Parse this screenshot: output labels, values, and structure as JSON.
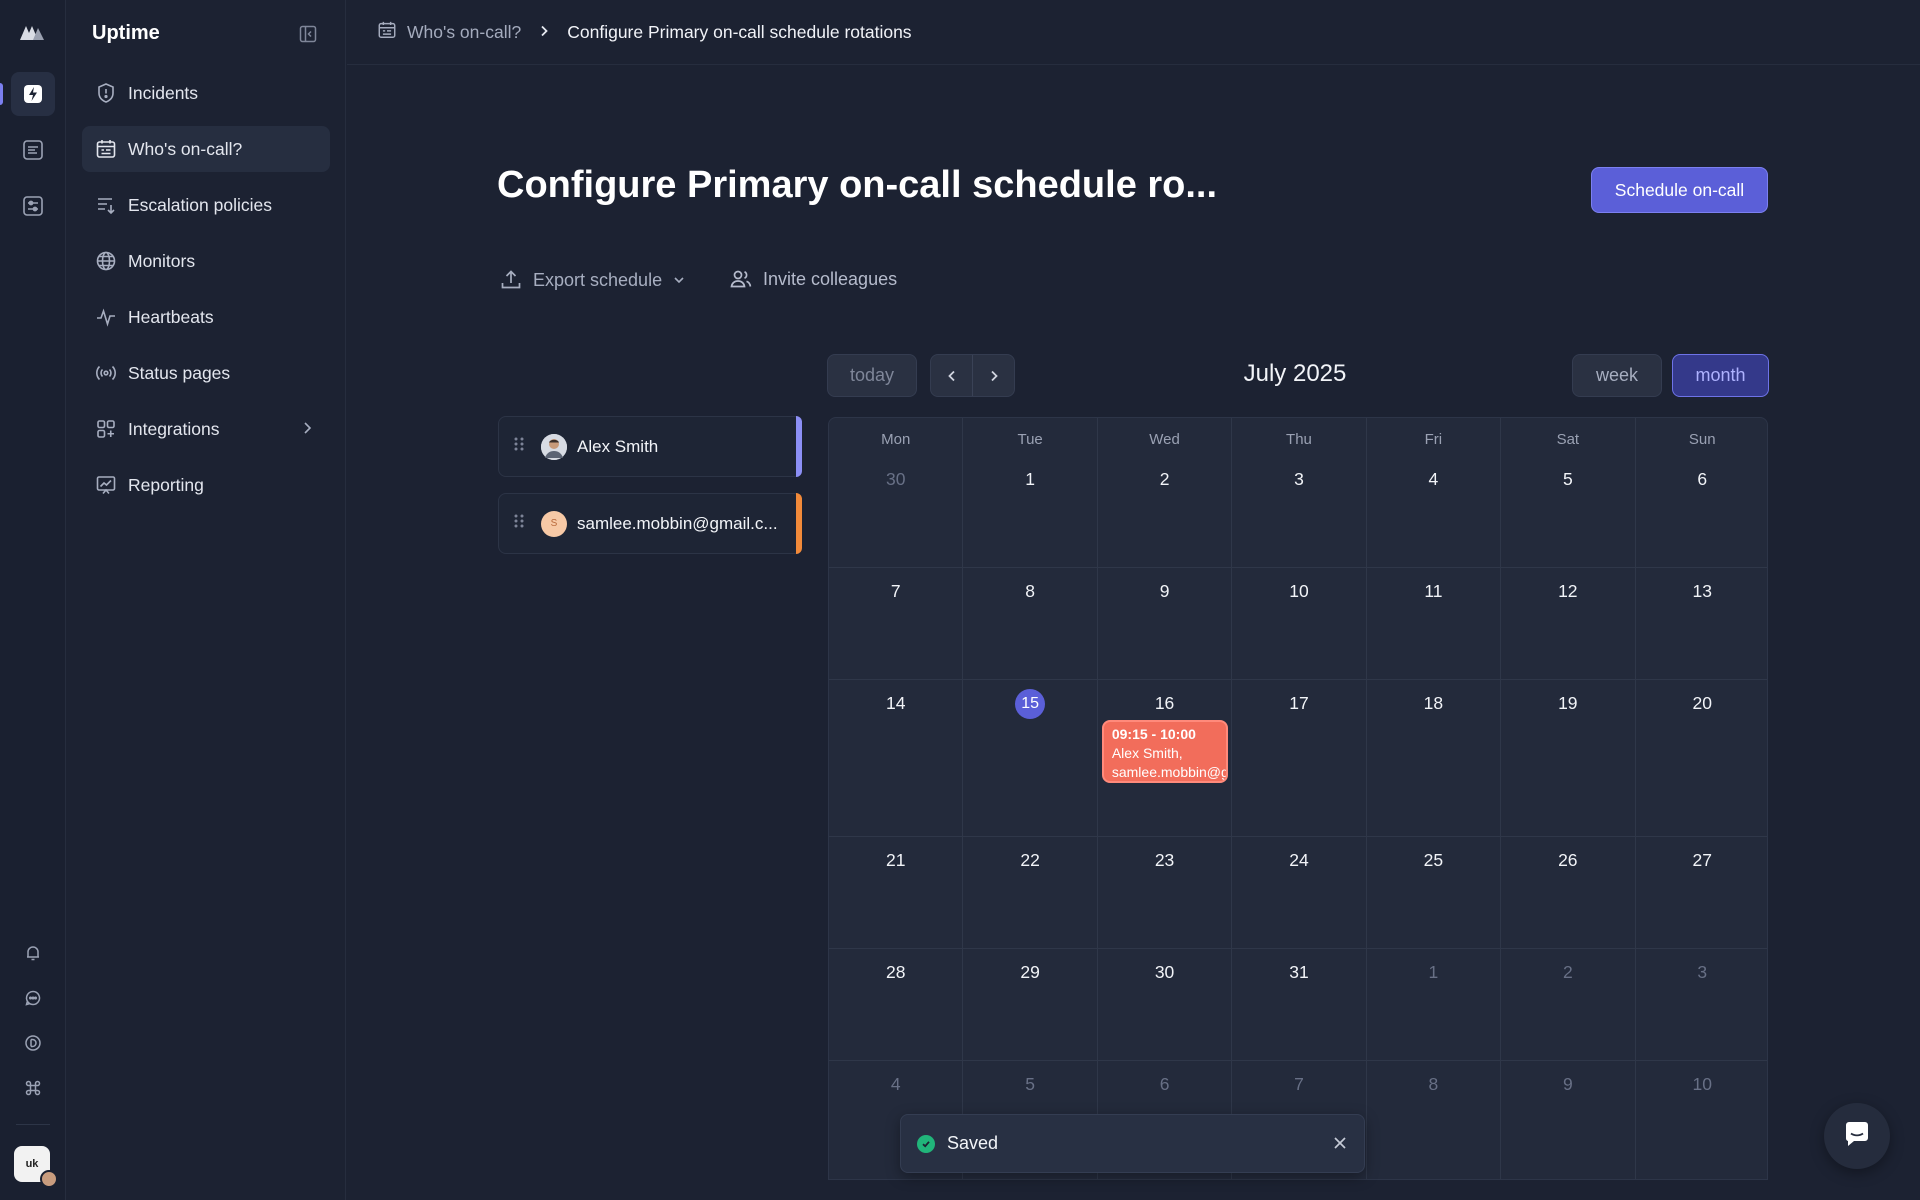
{
  "app": {
    "name": "Uptime"
  },
  "sidebar": {
    "items": [
      {
        "label": "Incidents",
        "icon": "shield-icon"
      },
      {
        "label": "Who's on-call?",
        "icon": "calendar-icon",
        "active": true
      },
      {
        "label": "Escalation policies",
        "icon": "list-arrow-icon"
      },
      {
        "label": "Monitors",
        "icon": "globe-icon"
      },
      {
        "label": "Heartbeats",
        "icon": "pulse-icon"
      },
      {
        "label": "Status pages",
        "icon": "broadcast-icon"
      },
      {
        "label": "Integrations",
        "icon": "grid-plus-icon",
        "has_submenu": true
      },
      {
        "label": "Reporting",
        "icon": "chart-icon"
      }
    ]
  },
  "rail": {
    "top_icons": [
      "lightning-icon",
      "document-list-icon",
      "settings-panel-icon"
    ],
    "bottom_icons": [
      "bell-icon",
      "chat-bubble-icon",
      "circle-d-icon",
      "command-icon"
    ],
    "avatar_text": "uk"
  },
  "breadcrumb": {
    "parent": "Who's on-call?",
    "current": "Configure Primary on-call schedule rotations"
  },
  "page": {
    "title": "Configure Primary on-call schedule ro...",
    "primary_button": "Schedule on-call",
    "export_label": "Export schedule",
    "invite_label": "Invite colleagues"
  },
  "participants": [
    {
      "name": "Alex Smith",
      "avatar": "",
      "color": "#8c8ff5"
    },
    {
      "name": "samlee.mobbin@gmail.c...",
      "avatar": "S",
      "color": "#f28a3a"
    }
  ],
  "calendar": {
    "today_label": "today",
    "title": "July 2025",
    "week_label": "week",
    "month_label": "month",
    "days_of_week": [
      "Mon",
      "Tue",
      "Wed",
      "Thu",
      "Fri",
      "Sat",
      "Sun"
    ],
    "weeks": [
      [
        "30",
        "1",
        "2",
        "3",
        "4",
        "5",
        "6"
      ],
      [
        "7",
        "8",
        "9",
        "10",
        "11",
        "12",
        "13"
      ],
      [
        "14",
        "15",
        "16",
        "17",
        "18",
        "19",
        "20"
      ],
      [
        "21",
        "22",
        "23",
        "24",
        "25",
        "26",
        "27"
      ],
      [
        "28",
        "29",
        "30",
        "31",
        "1",
        "2",
        "3"
      ],
      [
        "4",
        "5",
        "6",
        "7",
        "8",
        "9",
        "10"
      ]
    ],
    "today": "15",
    "event": {
      "time": "09:15 - 10:00",
      "line1": "Alex Smith,",
      "line2": "samlee.mobbin@gmail.com",
      "color": "#f26d5b"
    }
  },
  "toast": {
    "message": "Saved",
    "status_color": "#21b57a"
  },
  "colors": {
    "accent": "#5b5fd8",
    "background": "#1c2232"
  }
}
